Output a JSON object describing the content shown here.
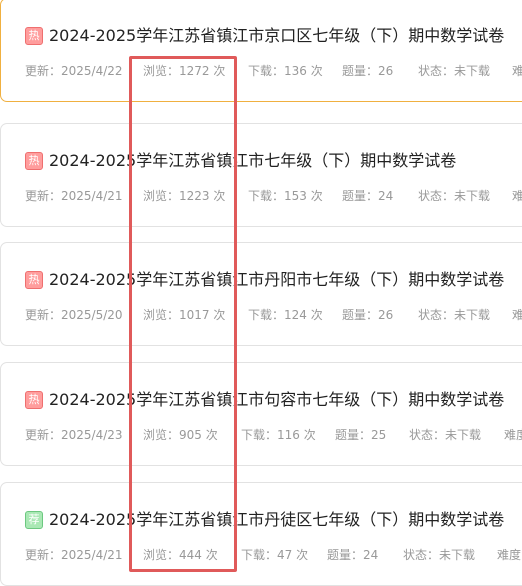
{
  "items": [
    {
      "badge": "热",
      "badge_type": "hot",
      "title": "2024-2025学年江苏省镇江市京口区七年级（下）期中数学试卷",
      "update": "更新：2025/4/22",
      "views": "浏览：1272 次",
      "downloads": "下载：136 次",
      "questions": "题量：26",
      "status": "状态：未下载",
      "difficulty": "难度"
    },
    {
      "badge": "热",
      "badge_type": "hot",
      "title": "2024-2025学年江苏省镇江市七年级（下）期中数学试卷",
      "update": "更新：2025/4/21",
      "views": "浏览：1223 次",
      "downloads": "下载：153 次",
      "questions": "题量：24",
      "status": "状态：未下载",
      "difficulty": "难度"
    },
    {
      "badge": "热",
      "badge_type": "hot",
      "title": "2024-2025学年江苏省镇江市丹阳市七年级（下）期中数学试卷",
      "update": "更新：2025/5/20",
      "views": "浏览：1017 次",
      "downloads": "下载：124 次",
      "questions": "题量：26",
      "status": "状态：未下载",
      "difficulty": "难度"
    },
    {
      "badge": "热",
      "badge_type": "hot",
      "title": "2024-2025学年江苏省镇江市句容市七年级（下）期中数学试卷",
      "update": "更新：2025/4/23",
      "views": "浏览：905 次",
      "downloads": "下载：116 次",
      "questions": "题量：25",
      "status": "状态：未下载",
      "difficulty": "难度"
    },
    {
      "badge": "荐",
      "badge_type": "store",
      "title": "2024-2025学年江苏省镇江市丹徒区七年级（下）期中数学试卷",
      "update": "更新：2025/4/21",
      "views": "浏览：444 次",
      "downloads": "下载：47 次",
      "questions": "题量：24",
      "status": "状态：未下载",
      "difficulty": "难度"
    }
  ],
  "colors": {
    "hot_badge": "#ff9d9d",
    "store_badge": "#a9e8b4",
    "active_border": "#f0b040",
    "highlight_box": "#e05a5a"
  }
}
